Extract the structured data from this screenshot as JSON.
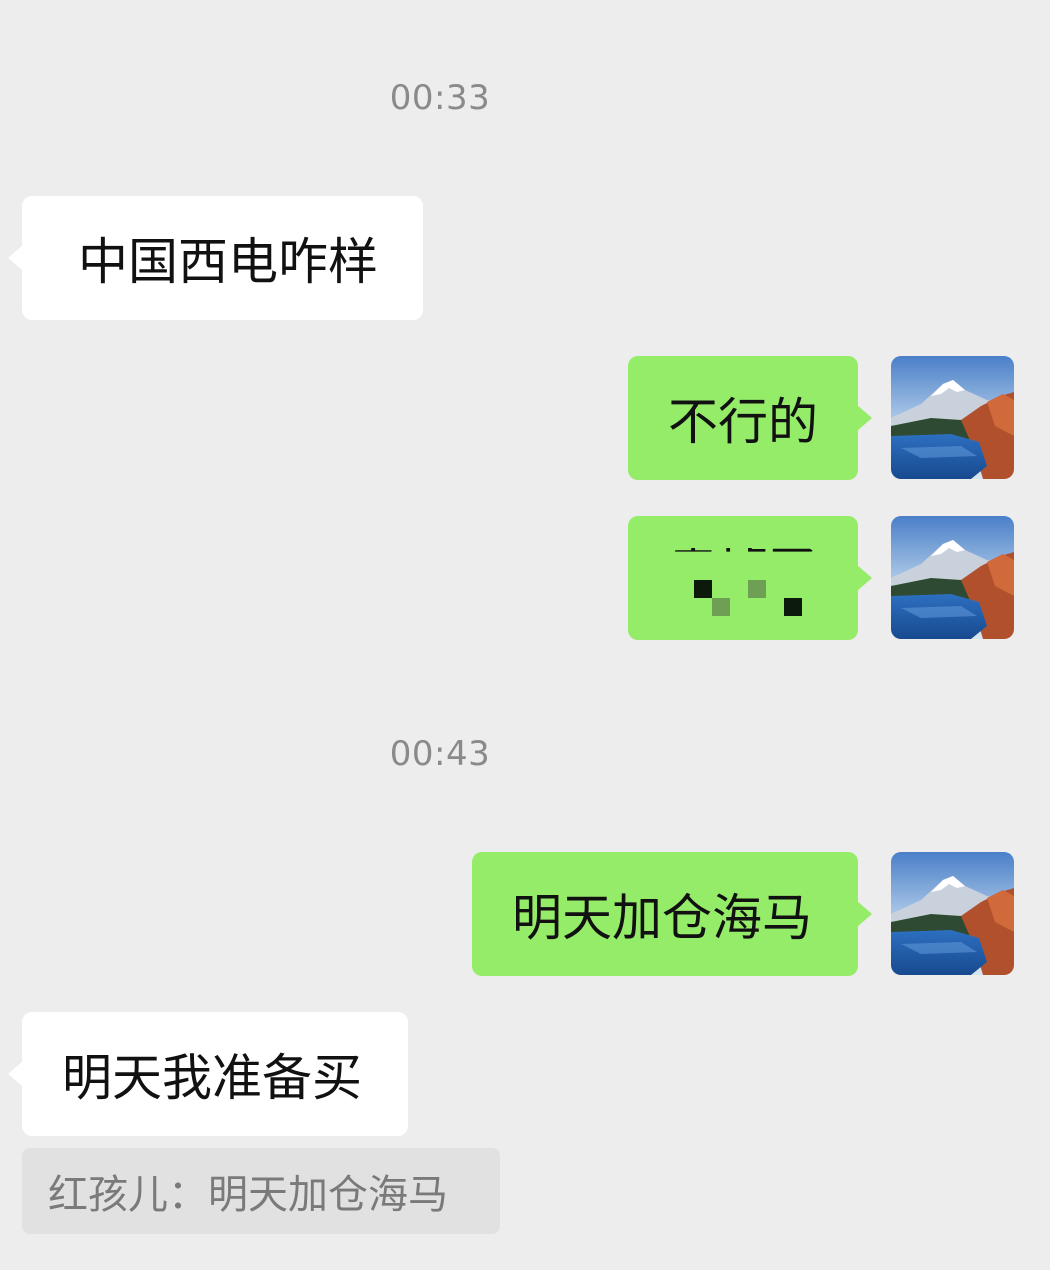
{
  "messages": {
    "time1": "00:33",
    "msg1_text": "中国西电咋样",
    "msg2_text": "不行的",
    "msg3_text": "卖掉了",
    "time2": "00:43",
    "msg4_text": "明天加仓海马",
    "msg5_text": "明天我准备买",
    "quote_text": "红孩儿：明天加仓海马"
  },
  "colors": {
    "background": "#ededed",
    "incoming_bubble": "#ffffff",
    "outgoing_bubble": "#95ec69",
    "timestamp": "#8a8a8a",
    "quote_bg": "#e1e1e1"
  },
  "icons": {
    "avatar": "mountain-lake-avatar-icon"
  }
}
